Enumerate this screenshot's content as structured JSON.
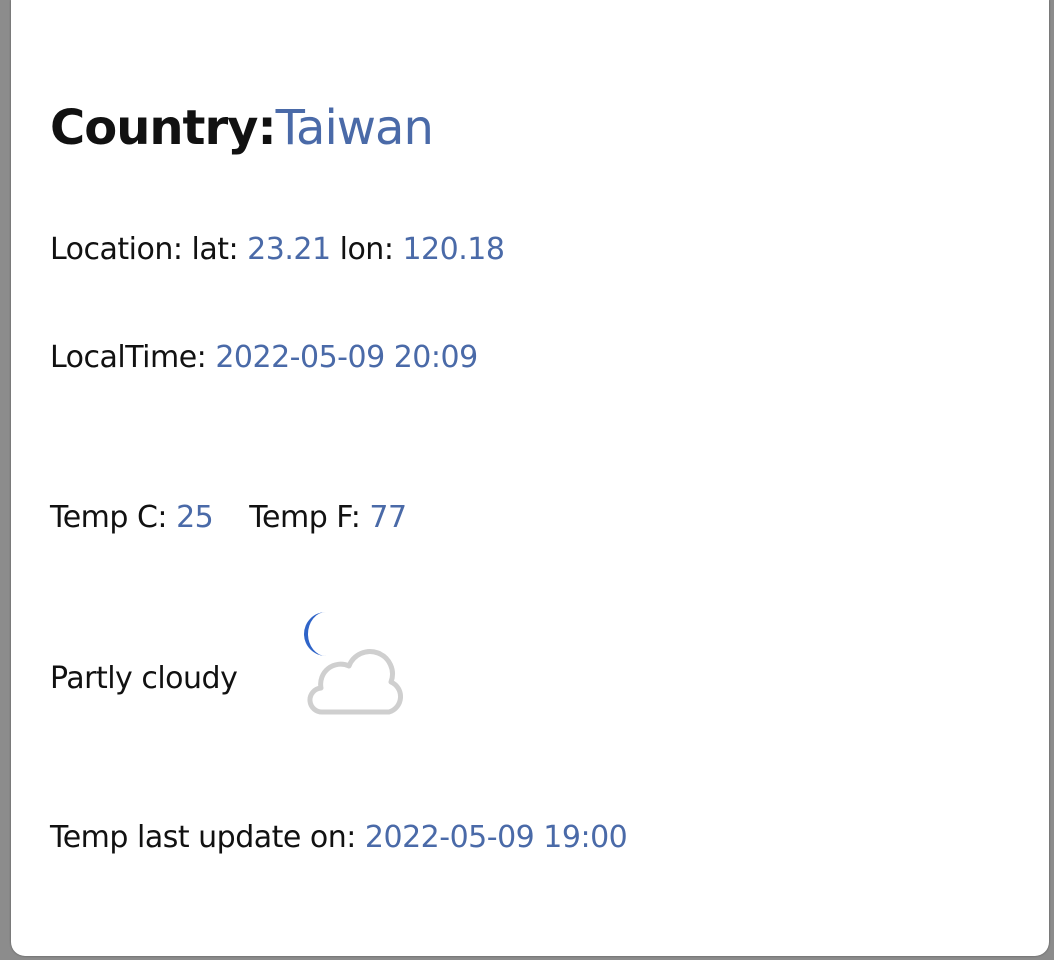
{
  "country": {
    "label": "Country:",
    "value": "Taiwan"
  },
  "location": {
    "label": "Location: lat:",
    "lat": "23.21",
    "lon_label": "lon:",
    "lon": "120.18"
  },
  "local_time": {
    "label": "LocalTime:",
    "value": "2022-05-09 20:09"
  },
  "temperature": {
    "c_label": "Temp C:",
    "c_value": "25",
    "f_label": "Temp F:",
    "f_value": "77"
  },
  "condition": {
    "text": "Partly cloudy",
    "icon": "partly-cloudy-night-icon"
  },
  "last_update": {
    "label": "Temp last update on:",
    "value": "2022-05-09 19:00"
  },
  "colors": {
    "value_text": "#4a6aa8",
    "moon": "#2f64c8",
    "cloud_outline": "#cfcfcf"
  }
}
